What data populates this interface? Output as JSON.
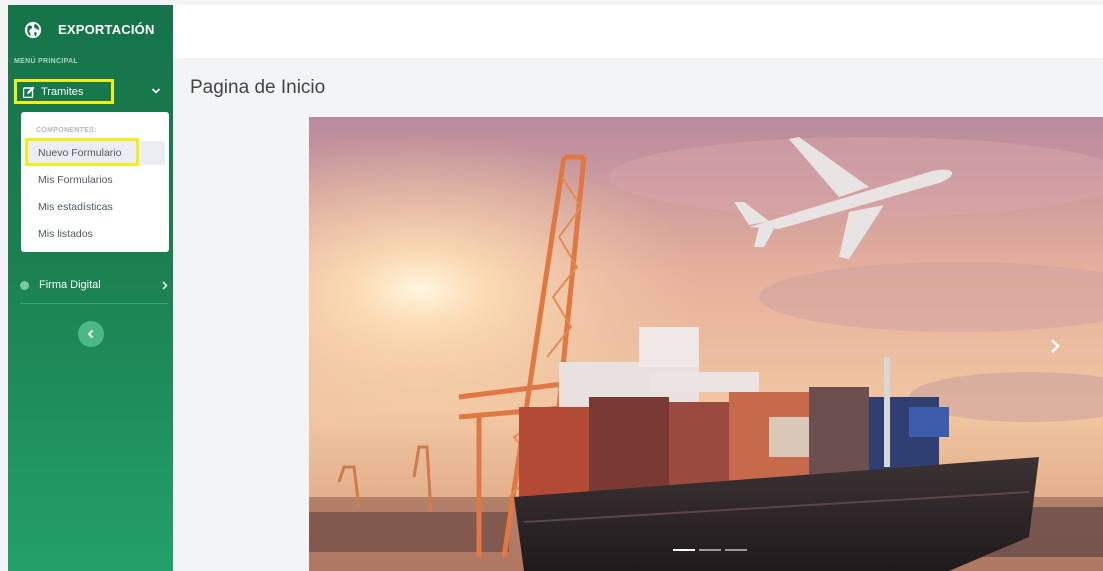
{
  "sidebar": {
    "brand_title": "EXPORTACIÓN",
    "section_label": "MENÚ PRINCIPAL",
    "tramites_label": "Tramites",
    "submenu": {
      "header": "COMPONENTES:",
      "items": [
        {
          "label": "Nuevo Formulario",
          "active": true
        },
        {
          "label": "Mis Formularios"
        },
        {
          "label": "Mis estadísticas"
        },
        {
          "label": "Mis listados"
        }
      ]
    },
    "firma_label": "Firma Digital",
    "colors": {
      "gradient_top": "#16734a",
      "gradient_bottom": "#23a06a",
      "highlight": "#f2ee1a"
    }
  },
  "main": {
    "page_title": "Pagina de Inicio"
  },
  "carousel": {
    "slide_count": 3,
    "active_index": 0
  }
}
